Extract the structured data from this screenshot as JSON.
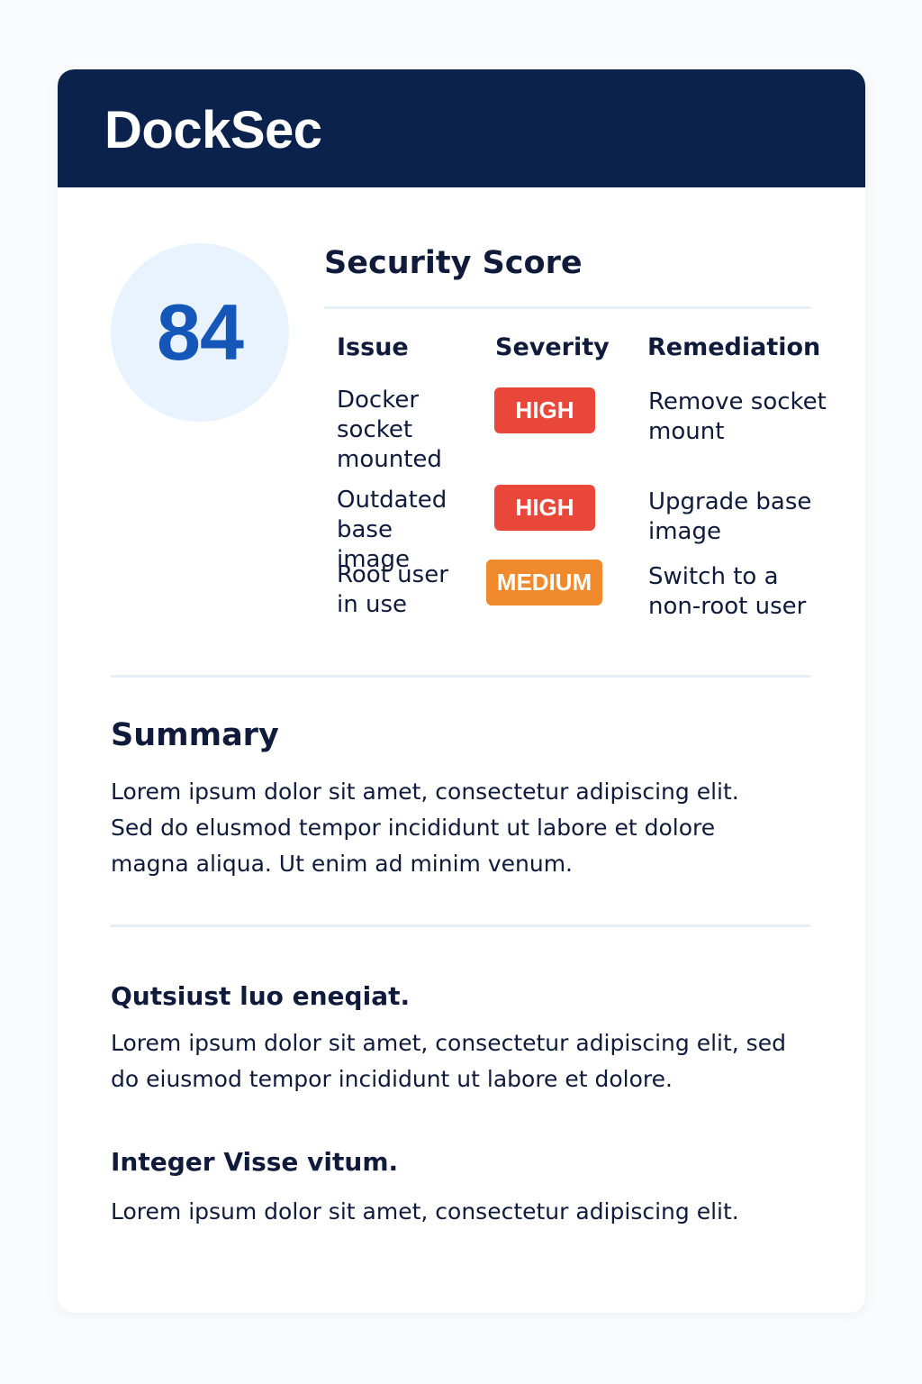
{
  "app": {
    "title": "DockSec"
  },
  "score": {
    "value": "84",
    "heading": "Security Score"
  },
  "issues_table": {
    "columns": [
      "Issue",
      "Severity",
      "Remediation"
    ],
    "rows": [
      {
        "issue_lines": [
          "Docker",
          "socket",
          "mounted"
        ],
        "severity": "HIGH",
        "remediation_lines": [
          "Remove socket",
          "mount"
        ]
      },
      {
        "issue_lines": [
          "Outdated",
          "base image"
        ],
        "severity": "HIGH",
        "remediation_lines": [
          "Upgrade base",
          "image"
        ]
      },
      {
        "issue_lines": [
          "Root user",
          "in use"
        ],
        "severity": "MEDIUM",
        "remediation_lines": [
          "Switch to a",
          "non-root user"
        ]
      }
    ]
  },
  "severity_colors": {
    "HIGH": "#e8473a",
    "MEDIUM": "#f08a2c"
  },
  "summary": {
    "title": "Summary",
    "body_lines": [
      "Lorem ipsum dolor sit amet, consectetur adipiscing elit.",
      "Sed do elusmod tempor incididunt ut labore et dolore",
      "magna aliqua. Ut enim ad minim venum."
    ]
  },
  "sections": [
    {
      "title": "Qutsiust luo eneqiat.",
      "body_lines": [
        "Lorem ipsum dolor sit amet, consectetur adipiscing elit, sed",
        "do eiusmod tempor incididunt ut labore et dolore."
      ]
    },
    {
      "title": "Integer Visse vitum.",
      "body_lines": [
        "Lorem ipsum dolor sit amet, consectetur adipiscing elit."
      ]
    }
  ],
  "colors": {
    "header_bg": "#0b224d",
    "score_circle_bg": "#e8f3fe",
    "score_text": "#1457b8",
    "divider": "#e6eef7"
  }
}
